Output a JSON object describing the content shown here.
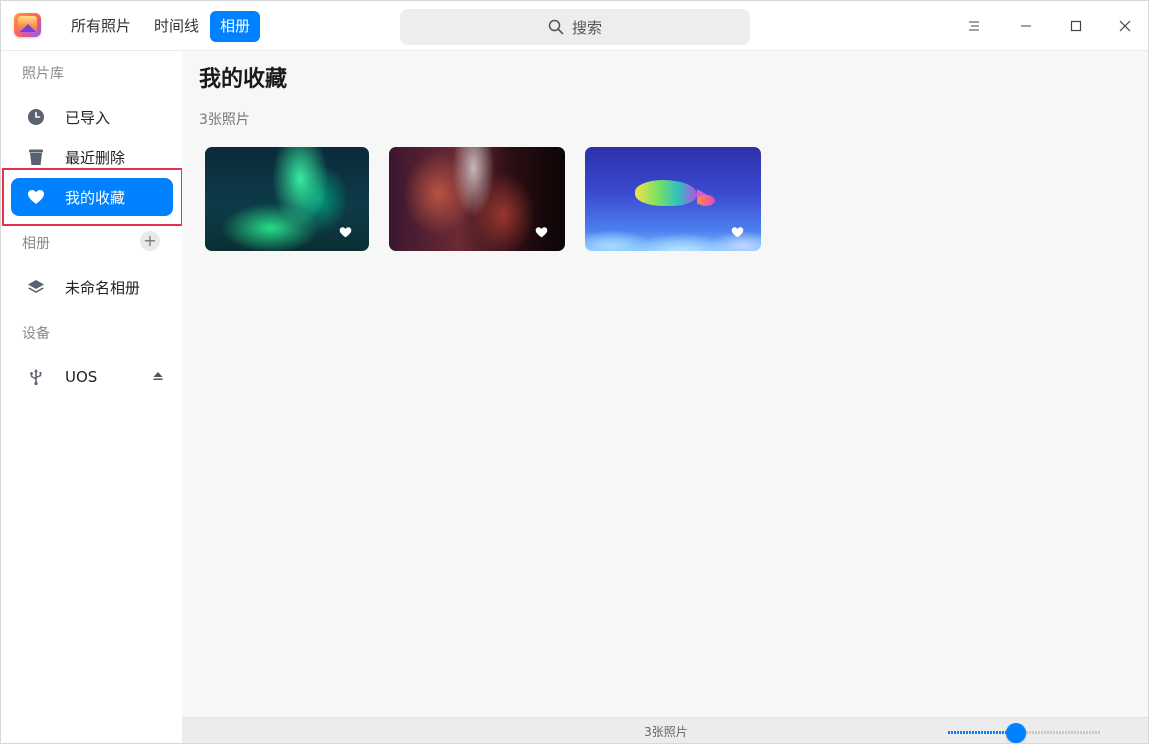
{
  "nav": {
    "tabs": [
      {
        "label": "所有照片"
      },
      {
        "label": "时间线"
      },
      {
        "label": "相册"
      }
    ]
  },
  "search": {
    "placeholder": "搜索"
  },
  "sidebar": {
    "library_title": "照片库",
    "items": [
      {
        "label": "已导入",
        "icon": "clock-icon"
      },
      {
        "label": "最近删除",
        "icon": "trash-icon"
      },
      {
        "label": "我的收藏",
        "icon": "heart-icon"
      }
    ],
    "albums_title": "相册",
    "albums": [
      {
        "label": "未命名相册",
        "icon": "layers-icon"
      }
    ],
    "devices_title": "设备",
    "devices": [
      {
        "label": "UOS",
        "icon": "usb-icon"
      }
    ]
  },
  "main": {
    "title": "我的收藏",
    "count": "3张照片",
    "photos": [
      {
        "name": "aurora",
        "favorited": true
      },
      {
        "name": "canyon",
        "favorited": true
      },
      {
        "name": "whale",
        "favorited": true
      }
    ]
  },
  "status": {
    "text": "3张照片",
    "zoom": 0.45
  },
  "colors": {
    "accent": "#0081ff",
    "highlight": "#e8304a"
  }
}
